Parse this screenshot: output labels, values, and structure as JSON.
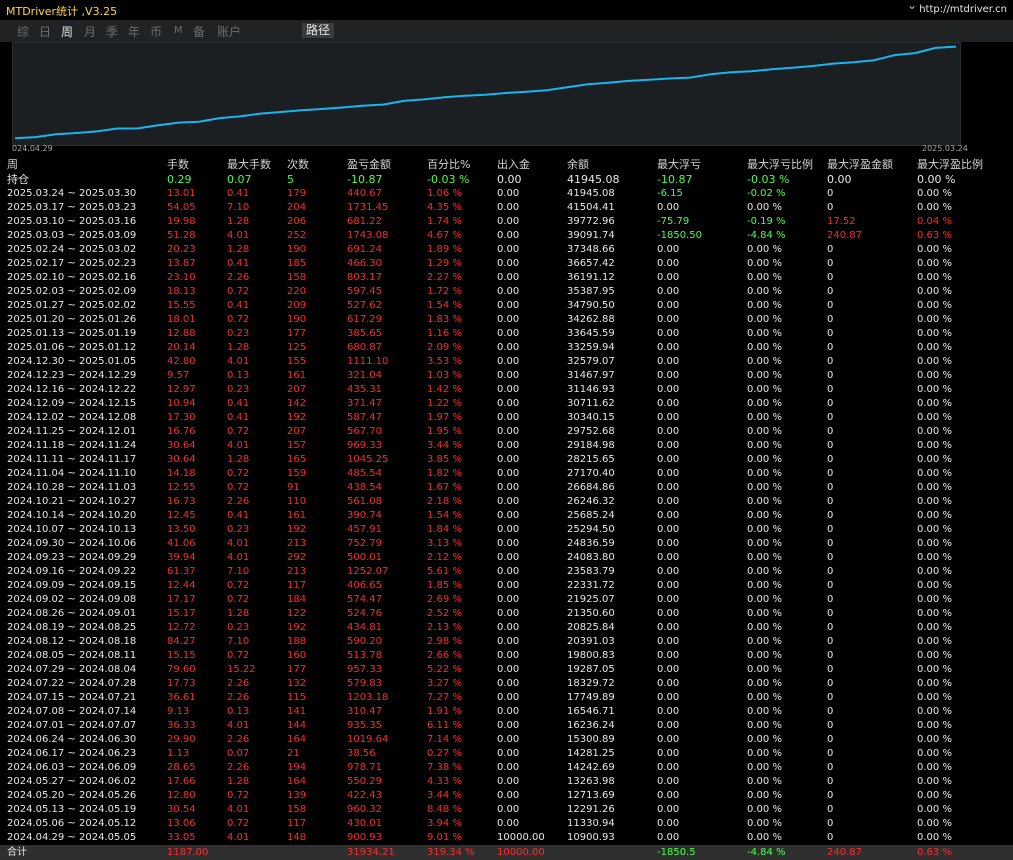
{
  "app_title": "MTDriver统计 ,V3.25",
  "url": "http://mtdriver.cn",
  "tabs": [
    "综",
    "日",
    "周",
    "月",
    "季",
    "年",
    "币",
    "M",
    "备",
    "账户"
  ],
  "active_tab": 2,
  "path_tab": "路径",
  "colors": {
    "red": "#ff2a2a",
    "green": "#4cff4c",
    "white": "#e8e8e8",
    "line": "#1ab4ee",
    "bg": "#000000"
  },
  "chart_data": {
    "type": "line",
    "x_start_label": "024.04.29",
    "x_end_label": "2025.03.24",
    "ymin": 10000,
    "ymax": 42500,
    "values": [
      10900.93,
      11330.94,
      12291.26,
      12713.69,
      13263.98,
      14242.69,
      14281.25,
      15300.89,
      16236.24,
      16546.71,
      17749.89,
      18329.72,
      19287.05,
      19800.83,
      20391.03,
      20825.84,
      21350.6,
      21925.07,
      22331.72,
      23583.79,
      24083.8,
      24836.59,
      25294.5,
      25685.24,
      26246.32,
      26684.86,
      27170.4,
      28215.65,
      29184.98,
      29752.68,
      30340.15,
      30711.62,
      31146.93,
      31467.97,
      32579.07,
      33259.94,
      33645.59,
      34262.88,
      34790.5,
      35387.95,
      36191.12,
      36657.42,
      37348.66,
      39091.74,
      39772.96,
      41504.41,
      41945.08
    ]
  },
  "headers": [
    "周",
    "手数",
    "最大手数",
    "次数",
    "盈亏金额",
    "百分比%",
    "出入金",
    "余额",
    "最大浮亏",
    "最大浮亏比例",
    "最大浮盈金额",
    "最大浮盈比例"
  ],
  "holding": [
    "持仓",
    "0.29",
    "0.07",
    "5",
    "-10.87",
    "-0.03 %",
    "0.00",
    "41945.08",
    "-10.87",
    "-0.03 %",
    "0.00",
    "0.00 %"
  ],
  "rows": [
    [
      "2025.03.24 ~ 2025.03.30",
      "13.01",
      "0.41",
      "179",
      "440.67",
      "1.06 %",
      "0.00",
      "41945.08",
      "-6.15",
      "-0.02 %",
      "0",
      "0.00 %"
    ],
    [
      "2025.03.17 ~ 2025.03.23",
      "54.05",
      "7.10",
      "204",
      "1731.45",
      "4.35 %",
      "0.00",
      "41504.41",
      "0.00",
      "0.00 %",
      "0",
      "0.00 %"
    ],
    [
      "2025.03.10 ~ 2025.03.16",
      "19.98",
      "1.28",
      "206",
      "681.22",
      "1.74 %",
      "0.00",
      "39772.96",
      "-75.79",
      "-0.19 %",
      "17.52",
      "0.04 %"
    ],
    [
      "2025.03.03 ~ 2025.03.09",
      "51.28",
      "4.01",
      "252",
      "1743.08",
      "4.67 %",
      "0.00",
      "39091.74",
      "-1850.50",
      "-4.84 %",
      "240.87",
      "0.63 %"
    ],
    [
      "2025.02.24 ~ 2025.03.02",
      "20.23",
      "1.28",
      "190",
      "691.24",
      "1.89 %",
      "0.00",
      "37348.66",
      "0.00",
      "0.00 %",
      "0",
      "0.00 %"
    ],
    [
      "2025.02.17 ~ 2025.02.23",
      "13.87",
      "0.41",
      "185",
      "466.30",
      "1.29 %",
      "0.00",
      "36657.42",
      "0.00",
      "0.00 %",
      "0",
      "0.00 %"
    ],
    [
      "2025.02.10 ~ 2025.02.16",
      "23.10",
      "2.26",
      "158",
      "803.17",
      "2.27 %",
      "0.00",
      "36191.12",
      "0.00",
      "0.00 %",
      "0",
      "0.00 %"
    ],
    [
      "2025.02.03 ~ 2025.02.09",
      "18.13",
      "0.72",
      "220",
      "597.45",
      "1.72 %",
      "0.00",
      "35387.95",
      "0.00",
      "0.00 %",
      "0",
      "0.00 %"
    ],
    [
      "2025.01.27 ~ 2025.02.02",
      "15.55",
      "0.41",
      "209",
      "527.62",
      "1.54 %",
      "0.00",
      "34790.50",
      "0.00",
      "0.00 %",
      "0",
      "0.00 %"
    ],
    [
      "2025.01.20 ~ 2025.01.26",
      "18.01",
      "0.72",
      "190",
      "617.29",
      "1.83 %",
      "0.00",
      "34262.88",
      "0.00",
      "0.00 %",
      "0",
      "0.00 %"
    ],
    [
      "2025.01.13 ~ 2025.01.19",
      "12.88",
      "0.23",
      "177",
      "385.65",
      "1.16 %",
      "0.00",
      "33645.59",
      "0.00",
      "0.00 %",
      "0",
      "0.00 %"
    ],
    [
      "2025.01.06 ~ 2025.01.12",
      "20.14",
      "1.28",
      "125",
      "680.87",
      "2.09 %",
      "0.00",
      "33259.94",
      "0.00",
      "0.00 %",
      "0",
      "0.00 %"
    ],
    [
      "2024.12.30 ~ 2025.01.05",
      "42.80",
      "4.01",
      "155",
      "1111.10",
      "3.53 %",
      "0.00",
      "32579.07",
      "0.00",
      "0.00 %",
      "0",
      "0.00 %"
    ],
    [
      "2024.12.23 ~ 2024.12.29",
      "9.57",
      "0.13",
      "161",
      "321.04",
      "1.03 %",
      "0.00",
      "31467.97",
      "0.00",
      "0.00 %",
      "0",
      "0.00 %"
    ],
    [
      "2024.12.16 ~ 2024.12.22",
      "12.97",
      "0.23",
      "207",
      "435.31",
      "1.42 %",
      "0.00",
      "31146.93",
      "0.00",
      "0.00 %",
      "0",
      "0.00 %"
    ],
    [
      "2024.12.09 ~ 2024.12.15",
      "10.94",
      "0.41",
      "142",
      "371.47",
      "1.22 %",
      "0.00",
      "30711.62",
      "0.00",
      "0.00 %",
      "0",
      "0.00 %"
    ],
    [
      "2024.12.02 ~ 2024.12.08",
      "17.30",
      "0.41",
      "192",
      "587.47",
      "1.97 %",
      "0.00",
      "30340.15",
      "0.00",
      "0.00 %",
      "0",
      "0.00 %"
    ],
    [
      "2024.11.25 ~ 2024.12.01",
      "16.76",
      "0.72",
      "207",
      "567.70",
      "1.95 %",
      "0.00",
      "29752.68",
      "0.00",
      "0.00 %",
      "0",
      "0.00 %"
    ],
    [
      "2024.11.18 ~ 2024.11.24",
      "30.64",
      "4.01",
      "157",
      "969.33",
      "3.44 %",
      "0.00",
      "29184.98",
      "0.00",
      "0.00 %",
      "0",
      "0.00 %"
    ],
    [
      "2024.11.11 ~ 2024.11.17",
      "30.64",
      "1.28",
      "165",
      "1045.25",
      "3.85 %",
      "0.00",
      "28215.65",
      "0.00",
      "0.00 %",
      "0",
      "0.00 %"
    ],
    [
      "2024.11.04 ~ 2024.11.10",
      "14.18",
      "0.72",
      "159",
      "485.54",
      "1.82 %",
      "0.00",
      "27170.40",
      "0.00",
      "0.00 %",
      "0",
      "0.00 %"
    ],
    [
      "2024.10.28 ~ 2024.11.03",
      "12.55",
      "0.72",
      "91",
      "438.54",
      "1.67 %",
      "0.00",
      "26684.86",
      "0.00",
      "0.00 %",
      "0",
      "0.00 %"
    ],
    [
      "2024.10.21 ~ 2024.10.27",
      "16.73",
      "2.26",
      "110",
      "561.08",
      "2.18 %",
      "0.00",
      "26246.32",
      "0.00",
      "0.00 %",
      "0",
      "0.00 %"
    ],
    [
      "2024.10.14 ~ 2024.10.20",
      "12.45",
      "0.41",
      "161",
      "390.74",
      "1.54 %",
      "0.00",
      "25685.24",
      "0.00",
      "0.00 %",
      "0",
      "0.00 %"
    ],
    [
      "2024.10.07 ~ 2024.10.13",
      "13.50",
      "0.23",
      "192",
      "457.91",
      "1.84 %",
      "0.00",
      "25294.50",
      "0.00",
      "0.00 %",
      "0",
      "0.00 %"
    ],
    [
      "2024.09.30 ~ 2024.10.06",
      "41.06",
      "4.01",
      "213",
      "752.79",
      "3.13 %",
      "0.00",
      "24836.59",
      "0.00",
      "0.00 %",
      "0",
      "0.00 %"
    ],
    [
      "2024.09.23 ~ 2024.09.29",
      "39.94",
      "4.01",
      "292",
      "500.01",
      "2.12 %",
      "0.00",
      "24083.80",
      "0.00",
      "0.00 %",
      "0",
      "0.00 %"
    ],
    [
      "2024.09.16 ~ 2024.09.22",
      "61.37",
      "7.10",
      "213",
      "1252.07",
      "5.61 %",
      "0.00",
      "23583.79",
      "0.00",
      "0.00 %",
      "0",
      "0.00 %"
    ],
    [
      "2024.09.09 ~ 2024.09.15",
      "12.44",
      "0.72",
      "117",
      "406.65",
      "1.85 %",
      "0.00",
      "22331.72",
      "0.00",
      "0.00 %",
      "0",
      "0.00 %"
    ],
    [
      "2024.09.02 ~ 2024.09.08",
      "17.17",
      "0.72",
      "184",
      "574.47",
      "2.69 %",
      "0.00",
      "21925.07",
      "0.00",
      "0.00 %",
      "0",
      "0.00 %"
    ],
    [
      "2024.08.26 ~ 2024.09.01",
      "15.17",
      "1.28",
      "122",
      "524.76",
      "2.52 %",
      "0.00",
      "21350.60",
      "0.00",
      "0.00 %",
      "0",
      "0.00 %"
    ],
    [
      "2024.08.19 ~ 2024.08.25",
      "12.72",
      "0.23",
      "192",
      "434.81",
      "2.13 %",
      "0.00",
      "20825.84",
      "0.00",
      "0.00 %",
      "0",
      "0.00 %"
    ],
    [
      "2024.08.12 ~ 2024.08.18",
      "84.27",
      "7.10",
      "188",
      "590.20",
      "2.98 %",
      "0.00",
      "20391.03",
      "0.00",
      "0.00 %",
      "0",
      "0.00 %"
    ],
    [
      "2024.08.05 ~ 2024.08.11",
      "15.15",
      "0.72",
      "160",
      "513.78",
      "2.66 %",
      "0.00",
      "19800.83",
      "0.00",
      "0.00 %",
      "0",
      "0.00 %"
    ],
    [
      "2024.07.29 ~ 2024.08.04",
      "79.60",
      "15.22",
      "177",
      "957.33",
      "5.22 %",
      "0.00",
      "19287.05",
      "0.00",
      "0.00 %",
      "0",
      "0.00 %"
    ],
    [
      "2024.07.22 ~ 2024.07.28",
      "17.73",
      "2.26",
      "132",
      "579.83",
      "3.27 %",
      "0.00",
      "18329.72",
      "0.00",
      "0.00 %",
      "0",
      "0.00 %"
    ],
    [
      "2024.07.15 ~ 2024.07.21",
      "36.61",
      "2.26",
      "115",
      "1203.18",
      "7.27 %",
      "0.00",
      "17749.89",
      "0.00",
      "0.00 %",
      "0",
      "0.00 %"
    ],
    [
      "2024.07.08 ~ 2024.07.14",
      "9.13",
      "0.13",
      "141",
      "310.47",
      "1.91 %",
      "0.00",
      "16546.71",
      "0.00",
      "0.00 %",
      "0",
      "0.00 %"
    ],
    [
      "2024.07.01 ~ 2024.07.07",
      "36.33",
      "4.01",
      "144",
      "935.35",
      "6.11 %",
      "0.00",
      "16236.24",
      "0.00",
      "0.00 %",
      "0",
      "0.00 %"
    ],
    [
      "2024.06.24 ~ 2024.06.30",
      "29.90",
      "2.26",
      "164",
      "1019.64",
      "7.14 %",
      "0.00",
      "15300.89",
      "0.00",
      "0.00 %",
      "0",
      "0.00 %"
    ],
    [
      "2024.06.17 ~ 2024.06.23",
      "1.13",
      "0.07",
      "21",
      "38.56",
      "0.27 %",
      "0.00",
      "14281.25",
      "0.00",
      "0.00 %",
      "0",
      "0.00 %"
    ],
    [
      "2024.06.03 ~ 2024.06.09",
      "28.65",
      "2.26",
      "194",
      "978.71",
      "7.38 %",
      "0.00",
      "14242.69",
      "0.00",
      "0.00 %",
      "0",
      "0.00 %"
    ],
    [
      "2024.05.27 ~ 2024.06.02",
      "17.66",
      "1.28",
      "164",
      "550.29",
      "4.33 %",
      "0.00",
      "13263.98",
      "0.00",
      "0.00 %",
      "0",
      "0.00 %"
    ],
    [
      "2024.05.20 ~ 2024.05.26",
      "12.80",
      "0.72",
      "139",
      "422.43",
      "3.44 %",
      "0.00",
      "12713.69",
      "0.00",
      "0.00 %",
      "0",
      "0.00 %"
    ],
    [
      "2024.05.13 ~ 2024.05.19",
      "30.54",
      "4.01",
      "158",
      "960.32",
      "8.48 %",
      "0.00",
      "12291.26",
      "0.00",
      "0.00 %",
      "0",
      "0.00 %"
    ],
    [
      "2024.05.06 ~ 2024.05.12",
      "13.06",
      "0.72",
      "117",
      "430.01",
      "3.94 %",
      "0.00",
      "11330.94",
      "0.00",
      "0.00 %",
      "0",
      "0.00 %"
    ],
    [
      "2024.04.29 ~ 2024.05.05",
      "33.05",
      "4.01",
      "148",
      "900.93",
      "9.01 %",
      "10000.00",
      "10900.93",
      "0.00",
      "0.00 %",
      "0",
      "0.00 %"
    ]
  ],
  "total": [
    "合计",
    "1187.00",
    "",
    "",
    "31934.21",
    "319.34 %",
    "10000.00",
    "",
    "-1850.5",
    "-4.84 %",
    "240.87",
    "0.63 %"
  ]
}
